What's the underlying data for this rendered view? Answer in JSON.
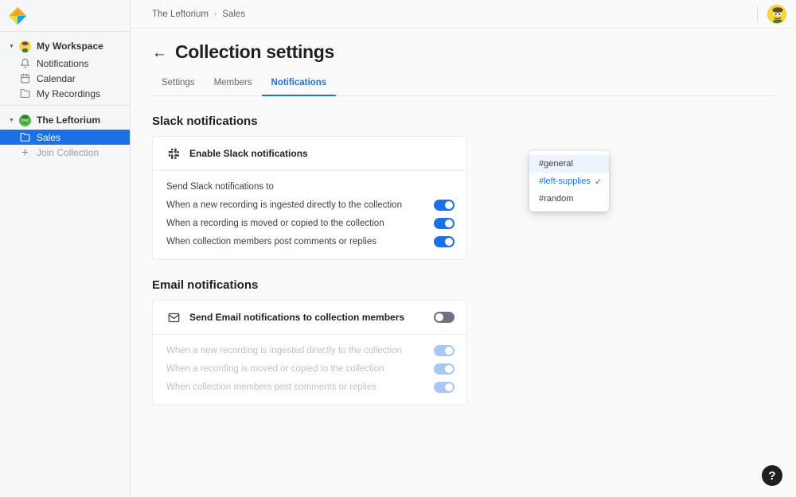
{
  "app": {
    "logo_name": "app-logo-diamond"
  },
  "sidebar": {
    "workspace": {
      "label": "My Workspace",
      "avatar_icon": "user-avatar-yellow",
      "caret_icon": "caret-down-icon"
    },
    "workspace_items": [
      {
        "label": "Notifications",
        "icon": "bell-icon"
      },
      {
        "label": "Calendar",
        "icon": "calendar-icon"
      },
      {
        "label": "My Recordings",
        "icon": "folder-icon"
      }
    ],
    "team": {
      "label": "The Leftorium",
      "avatar_icon": "team-avatar-green",
      "caret_icon": "caret-down-icon"
    },
    "team_items": [
      {
        "label": "Sales",
        "icon": "folder-icon",
        "selected": true
      },
      {
        "label": "Join Collection",
        "icon": "plus-icon",
        "selected": false
      }
    ]
  },
  "topbar": {
    "breadcrumb": [
      "The Leftorium",
      "Sales"
    ],
    "breadcrumb_separator": "›",
    "avatar_icon": "user-avatar-yellow"
  },
  "page": {
    "back_icon": "arrow-left-icon",
    "title": "Collection settings",
    "tabs": [
      {
        "label": "Settings",
        "active": false
      },
      {
        "label": "Members",
        "active": false
      },
      {
        "label": "Notifications",
        "active": true
      }
    ]
  },
  "slack": {
    "section_title": "Slack notifications",
    "icon": "slack-icon",
    "enable_label": "Enable Slack notifications",
    "rows": [
      {
        "label": "Send Slack notifications to",
        "toggle": "hidden"
      },
      {
        "label": "When a new recording is ingested directly to the collection",
        "toggle": "on"
      },
      {
        "label": "When a recording is moved or copied to the collection",
        "toggle": "on"
      },
      {
        "label": "When collection members post comments or replies",
        "toggle": "on"
      }
    ]
  },
  "channel_dropdown": {
    "name": "slack-channel-dropdown",
    "check_glyph": "✓",
    "options": [
      {
        "label": "#general",
        "selected": false,
        "hover": true
      },
      {
        "label": "#left-supplies",
        "selected": true,
        "hover": false
      },
      {
        "label": "#random",
        "selected": false,
        "hover": false
      }
    ]
  },
  "email": {
    "section_title": "Email notifications",
    "icon": "envelope-icon",
    "enable_label": "Send Email notifications to collection members",
    "master_toggle": "off",
    "rows": [
      {
        "label": "When a new recording is ingested directly to the collection",
        "toggle": "faded"
      },
      {
        "label": "When a recording is moved or copied to the collection",
        "toggle": "faded"
      },
      {
        "label": "When collection members post comments or replies",
        "toggle": "faded"
      }
    ]
  },
  "help": {
    "label": "?",
    "name": "help-button"
  },
  "colors": {
    "accent": "#1b72e8",
    "sidebar_bg": "#f5f6f7",
    "main_bg": "#fafafa",
    "card_bg": "#ffffff",
    "toggle_off": "#6b7280",
    "toggle_faded": "#a8c7f2",
    "text_primary": "#202124",
    "text_muted": "#9aa0a6"
  }
}
